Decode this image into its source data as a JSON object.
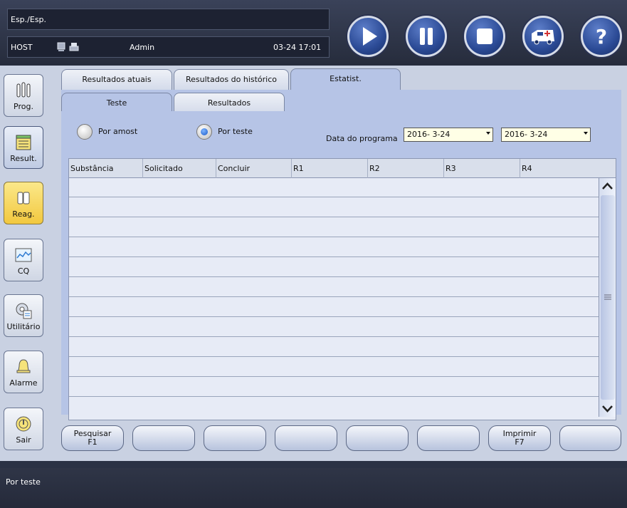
{
  "header": {
    "mode": "Esp./Esp.",
    "host": "HOST",
    "user": "Admin",
    "datetime": "03-24 17:01"
  },
  "controls": {
    "play_icon": "play-icon",
    "pause_icon": "pause-icon",
    "stop_icon": "stop-icon",
    "emergency_icon": "ambulance-icon",
    "help_icon": "help-icon"
  },
  "sidebar": {
    "items": [
      {
        "label": "Prog.",
        "icon": "test-tubes-icon"
      },
      {
        "label": "Result.",
        "icon": "results-icon"
      },
      {
        "label": "Reag.",
        "icon": "reagent-icon"
      },
      {
        "label": "CQ",
        "icon": "qc-chart-icon"
      },
      {
        "label": "Utilitário",
        "icon": "utility-gear-icon"
      },
      {
        "label": "Alarme",
        "icon": "bell-icon"
      },
      {
        "label": "Sair",
        "icon": "power-icon"
      }
    ]
  },
  "tabs": {
    "main": [
      {
        "label": "Resultados atuais"
      },
      {
        "label": "Resultados do histórico"
      },
      {
        "label": "Estatist."
      }
    ],
    "sub": [
      {
        "label": "Teste"
      },
      {
        "label": "Resultados"
      }
    ]
  },
  "filters": {
    "by_sample": "Por amost",
    "by_test": "Por teste",
    "date_label": "Data do programa",
    "date_from": "2016- 3-24",
    "date_to": "2016- 3-24"
  },
  "table": {
    "columns": [
      "Substância",
      "Solicitado",
      "Concluir",
      "R1",
      "R2",
      "R3",
      "R4"
    ]
  },
  "buttons": {
    "search": "Pesquisar",
    "search_key": "F1",
    "print": "Imprimir",
    "print_key": "F7"
  },
  "status": {
    "text": "Por teste"
  }
}
